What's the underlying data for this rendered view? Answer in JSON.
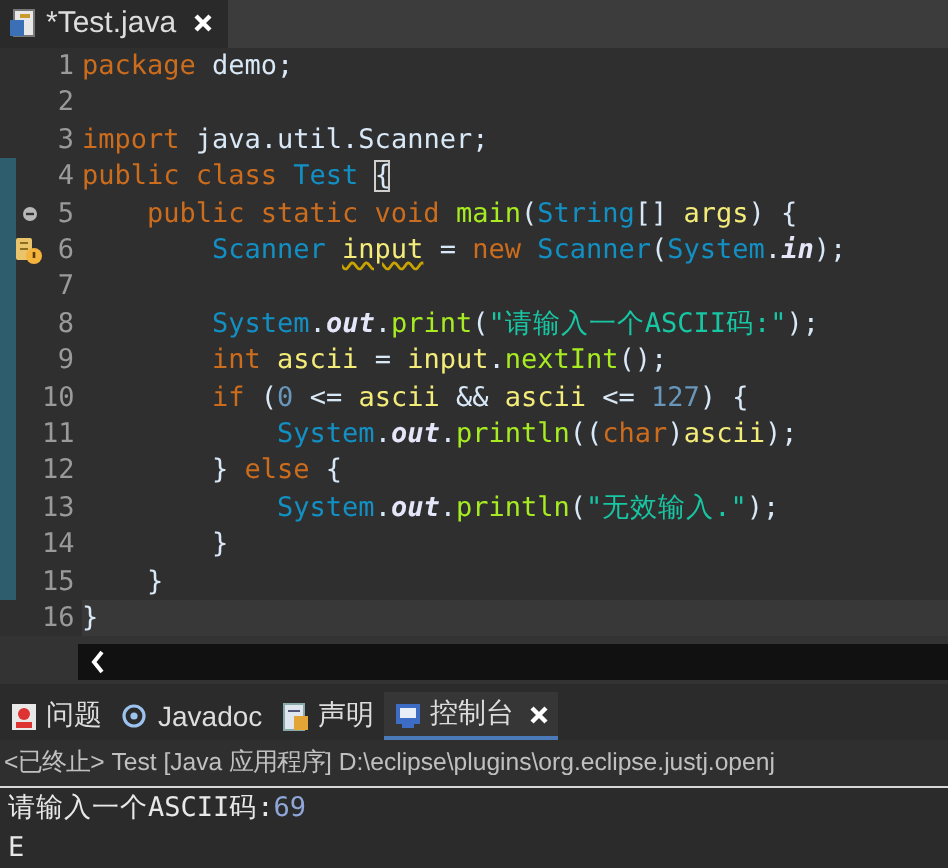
{
  "editor_tab": {
    "title": "*Test.java",
    "selected": true
  },
  "code_lines": [
    {
      "number": "1",
      "kind": "plain",
      "changed": false,
      "current": false,
      "tokens": [
        {
          "kind": "kw",
          "t": "package "
        },
        {
          "kind": "plain",
          "t": "demo;"
        }
      ]
    },
    {
      "number": "2",
      "kind": "plain",
      "changed": false,
      "current": false
    },
    {
      "number": "3",
      "kind": "plain",
      "changed": false,
      "current": false,
      "tokens": [
        {
          "kind": "kw",
          "t": "import "
        },
        {
          "kind": "plain",
          "t": "java.util.Scanner;"
        }
      ]
    },
    {
      "number": "4",
      "kind": "plain",
      "changed": true,
      "current": false,
      "tokens": [
        {
          "kind": "kw",
          "t": "public class "
        },
        {
          "kind": "type",
          "t": "Test "
        },
        {
          "kind": "match",
          "t": "{"
        }
      ]
    },
    {
      "number": "5",
      "kind": "fold",
      "changed": true,
      "current": false,
      "tokens": [
        {
          "kind": "kw",
          "t": "    public static void "
        },
        {
          "kind": "method",
          "t": "main"
        },
        {
          "kind": "plain",
          "t": "("
        },
        {
          "kind": "type",
          "t": "String"
        },
        {
          "kind": "plain",
          "t": "[] "
        },
        {
          "kind": "var",
          "t": "args"
        },
        {
          "kind": "plain",
          "t": ") {"
        }
      ]
    },
    {
      "number": "6",
      "kind": "warning",
      "changed": true,
      "current": false,
      "tokens": [
        {
          "kind": "type",
          "t": "        Scanner "
        },
        {
          "kind": "warn",
          "t": "input"
        },
        {
          "kind": "plain",
          "t": " = "
        },
        {
          "kind": "kw",
          "t": "new "
        },
        {
          "kind": "type",
          "t": "Scanner"
        },
        {
          "kind": "plain",
          "t": "("
        },
        {
          "kind": "type",
          "t": "System"
        },
        {
          "kind": "plain",
          "t": "."
        },
        {
          "kind": "field",
          "t": "in"
        },
        {
          "kind": "plain",
          "t": ");"
        }
      ]
    },
    {
      "number": "7",
      "kind": "plain",
      "changed": true,
      "current": false
    },
    {
      "number": "8",
      "kind": "plain",
      "changed": true,
      "current": false,
      "tokens": [
        {
          "kind": "type",
          "t": "        System"
        },
        {
          "kind": "plain",
          "t": "."
        },
        {
          "kind": "field",
          "t": "out"
        },
        {
          "kind": "plain",
          "t": "."
        },
        {
          "kind": "method",
          "t": "print"
        },
        {
          "kind": "plain",
          "t": "("
        },
        {
          "kind": "str",
          "t": "\"请输入一个ASCII码:\""
        },
        {
          "kind": "plain",
          "t": ");"
        }
      ]
    },
    {
      "number": "9",
      "kind": "plain",
      "changed": true,
      "current": false,
      "tokens": [
        {
          "kind": "kw",
          "t": "        int "
        },
        {
          "kind": "var",
          "t": "ascii"
        },
        {
          "kind": "plain",
          "t": " = "
        },
        {
          "kind": "var",
          "t": "input"
        },
        {
          "kind": "plain",
          "t": "."
        },
        {
          "kind": "method",
          "t": "nextInt"
        },
        {
          "kind": "plain",
          "t": "();"
        }
      ]
    },
    {
      "number": "10",
      "kind": "plain",
      "changed": true,
      "current": false,
      "tokens": [
        {
          "kind": "kw",
          "t": "        if "
        },
        {
          "kind": "plain",
          "t": "("
        },
        {
          "kind": "num",
          "t": "0"
        },
        {
          "kind": "plain",
          "t": " <= "
        },
        {
          "kind": "var",
          "t": "ascii"
        },
        {
          "kind": "plain",
          "t": " && "
        },
        {
          "kind": "var",
          "t": "ascii"
        },
        {
          "kind": "plain",
          "t": " <= "
        },
        {
          "kind": "num",
          "t": "127"
        },
        {
          "kind": "plain",
          "t": ") {"
        }
      ]
    },
    {
      "number": "11",
      "kind": "plain",
      "changed": true,
      "current": false,
      "tokens": [
        {
          "kind": "type",
          "t": "            System"
        },
        {
          "kind": "plain",
          "t": "."
        },
        {
          "kind": "field",
          "t": "out"
        },
        {
          "kind": "plain",
          "t": "."
        },
        {
          "kind": "method",
          "t": "println"
        },
        {
          "kind": "plain",
          "t": "(("
        },
        {
          "kind": "kw",
          "t": "char"
        },
        {
          "kind": "plain",
          "t": ")"
        },
        {
          "kind": "var",
          "t": "ascii"
        },
        {
          "kind": "plain",
          "t": ");"
        }
      ]
    },
    {
      "number": "12",
      "kind": "plain",
      "changed": true,
      "current": false,
      "tokens": [
        {
          "kind": "plain",
          "t": "        } "
        },
        {
          "kind": "kw",
          "t": "else"
        },
        {
          "kind": "plain",
          "t": " {"
        }
      ]
    },
    {
      "number": "13",
      "kind": "plain",
      "changed": true,
      "current": false,
      "tokens": [
        {
          "kind": "type",
          "t": "            System"
        },
        {
          "kind": "plain",
          "t": "."
        },
        {
          "kind": "field",
          "t": "out"
        },
        {
          "kind": "plain",
          "t": "."
        },
        {
          "kind": "method",
          "t": "println"
        },
        {
          "kind": "plain",
          "t": "("
        },
        {
          "kind": "str",
          "t": "\"无效输入.\""
        },
        {
          "kind": "plain",
          "t": ");"
        }
      ]
    },
    {
      "number": "14",
      "kind": "plain",
      "changed": true,
      "current": false,
      "tokens": [
        {
          "kind": "plain",
          "t": "        }"
        }
      ]
    },
    {
      "number": "15",
      "kind": "plain",
      "changed": true,
      "current": false,
      "tokens": [
        {
          "kind": "plain",
          "t": "    }"
        }
      ]
    },
    {
      "number": "16",
      "kind": "plain",
      "changed": false,
      "current": true,
      "tokens": [
        {
          "kind": "plain",
          "t": "}"
        }
      ]
    }
  ],
  "panel_tabs": [
    {
      "label": "问题",
      "selected": false
    },
    {
      "label": "Javadoc",
      "selected": false
    },
    {
      "label": "声明",
      "selected": false
    },
    {
      "label": "控制台",
      "selected": true
    }
  ],
  "console": {
    "header": "<已终止> Test [Java 应用程序] D:\\eclipse\\plugins\\org.eclipse.justj.openj",
    "lines": [
      [
        {
          "kind": "out",
          "t": "请输入一个ASCII码:"
        },
        {
          "kind": "in",
          "t": "69"
        }
      ],
      [
        {
          "kind": "out",
          "t": "E"
        }
      ]
    ]
  }
}
